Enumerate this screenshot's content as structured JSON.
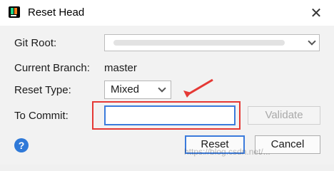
{
  "window": {
    "title": "Reset Head",
    "close_glyph": "✕"
  },
  "form": {
    "git_root": {
      "label": "Git Root:",
      "value": ""
    },
    "current_branch": {
      "label": "Current Branch:",
      "value": "master"
    },
    "reset_type": {
      "label": "Reset Type:",
      "value": "Mixed"
    },
    "to_commit": {
      "label": "To Commit:",
      "value": ""
    }
  },
  "buttons": {
    "validate": "Validate",
    "reset": "Reset",
    "cancel": "Cancel",
    "help": "?"
  },
  "watermark": "https://blog.csdn.net/...",
  "colors": {
    "accent": "#3b7bdc",
    "annotation": "#e53935"
  }
}
